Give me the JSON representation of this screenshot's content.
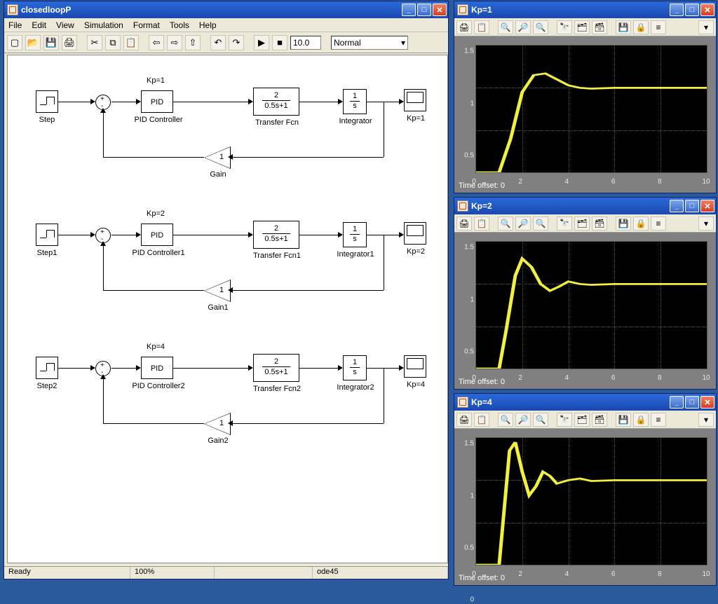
{
  "simwin": {
    "title": "closedloopP",
    "menu": [
      "File",
      "Edit",
      "View",
      "Simulation",
      "Format",
      "Tools",
      "Help"
    ],
    "stopTime": "10.0",
    "mode": "Normal",
    "status": {
      "ready": "Ready",
      "zoom": "100%",
      "blank": "",
      "solver": "ode45"
    }
  },
  "loops": [
    {
      "kp": "Kp=1",
      "step": "Step",
      "pidlbl": "PID Controller",
      "pid": "PID",
      "tfnum": "2",
      "tfden": "0.5s+1",
      "tflbl": "Transfer Fcn",
      "intnum": "1",
      "intden": "s",
      "intlbl": "Integrator",
      "scopelbl": "Kp=1",
      "gainv": "1",
      "gainlbl": "Gain"
    },
    {
      "kp": "Kp=2",
      "step": "Step1",
      "pidlbl": "PID Controller1",
      "pid": "PID",
      "tfnum": "2",
      "tfden": "0.5s+1",
      "tflbl": "Transfer Fcn1",
      "intnum": "1",
      "intden": "s",
      "intlbl": "Integrator1",
      "scopelbl": "Kp=2",
      "gainv": "1",
      "gainlbl": "Gain1"
    },
    {
      "kp": "Kp=4",
      "step": "Step2",
      "pidlbl": "PID Controller2",
      "pid": "PID",
      "tfnum": "2",
      "tfden": "0.5s+1",
      "tflbl": "Transfer Fcn2",
      "intnum": "1",
      "intden": "s",
      "intlbl": "Integrator2",
      "scopelbl": "Kp=4",
      "gainv": "1",
      "gainlbl": "Gain2"
    }
  ],
  "scopes": [
    {
      "title": "Kp=1",
      "offset": "Time offset:   0"
    },
    {
      "title": "Kp=2",
      "offset": "Time offset:   0"
    },
    {
      "title": "Kp=4",
      "offset": "Time offset:   0"
    }
  ],
  "chart_data": [
    {
      "type": "line",
      "title": "Kp=1",
      "xlabel": "",
      "ylabel": "",
      "xlim": [
        0,
        10
      ],
      "ylim": [
        0,
        1.5
      ],
      "xticks": [
        0,
        2,
        4,
        6,
        8,
        10
      ],
      "yticks": [
        0,
        0.5,
        1,
        1.5
      ],
      "x": [
        0,
        1,
        1.5,
        2,
        2.5,
        3,
        3.5,
        4,
        4.5,
        5,
        6,
        7,
        8,
        9,
        10
      ],
      "y": [
        0,
        0,
        0.4,
        0.95,
        1.15,
        1.17,
        1.1,
        1.03,
        1.0,
        0.99,
        1.0,
        1.0,
        1.0,
        1.0,
        1.0
      ]
    },
    {
      "type": "line",
      "title": "Kp=2",
      "xlabel": "",
      "ylabel": "",
      "xlim": [
        0,
        10
      ],
      "ylim": [
        0,
        1.5
      ],
      "xticks": [
        0,
        2,
        4,
        6,
        8,
        10
      ],
      "yticks": [
        0,
        0.5,
        1,
        1.5
      ],
      "x": [
        0,
        1,
        1.3,
        1.7,
        2,
        2.4,
        2.8,
        3.2,
        3.6,
        4,
        4.5,
        5,
        6,
        7,
        8,
        9,
        10
      ],
      "y": [
        0,
        0,
        0.45,
        1.1,
        1.3,
        1.2,
        1.0,
        0.92,
        0.97,
        1.03,
        1.0,
        0.99,
        1.0,
        1.0,
        1.0,
        1.0,
        1.0
      ]
    },
    {
      "type": "line",
      "title": "Kp=4",
      "xlabel": "",
      "ylabel": "",
      "xlim": [
        0,
        10
      ],
      "ylim": [
        0,
        1.5
      ],
      "xticks": [
        0,
        2,
        4,
        6,
        8,
        10
      ],
      "yticks": [
        0,
        0.5,
        1,
        1.5
      ],
      "x": [
        0,
        1,
        1.2,
        1.45,
        1.7,
        2,
        2.3,
        2.6,
        2.9,
        3.2,
        3.5,
        4,
        4.5,
        5,
        6,
        7,
        8,
        9,
        10
      ],
      "y": [
        0,
        0,
        0.6,
        1.35,
        1.45,
        1.1,
        0.82,
        0.93,
        1.1,
        1.05,
        0.96,
        1.0,
        1.02,
        0.99,
        1.0,
        1.0,
        1.0,
        1.0,
        1.0
      ]
    }
  ]
}
